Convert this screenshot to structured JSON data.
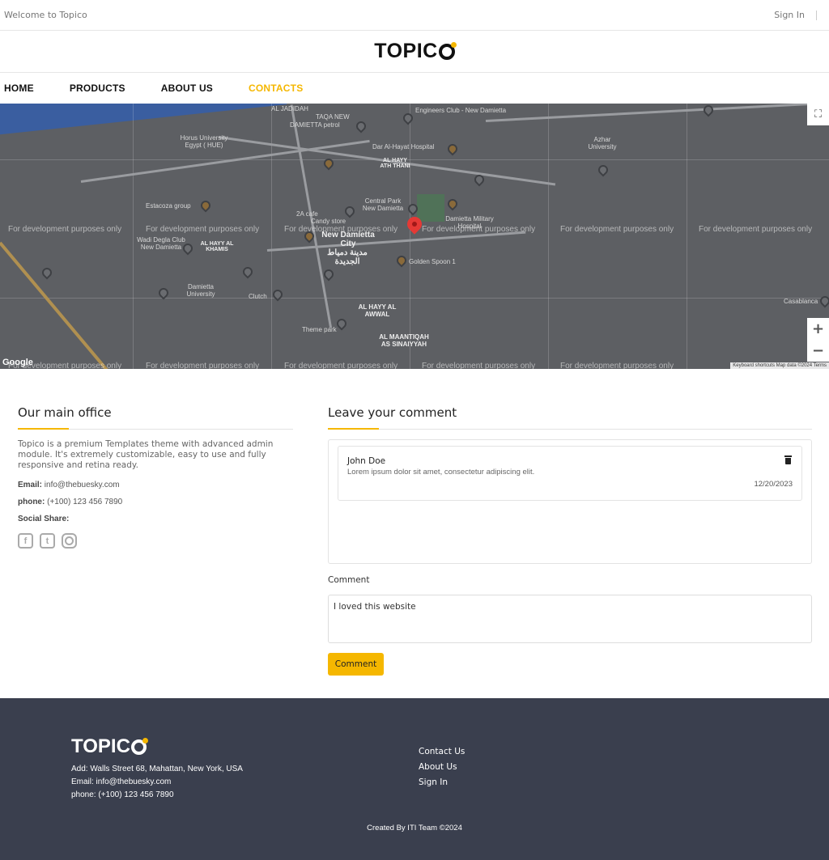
{
  "topbar": {
    "welcome": "Welcome to Topico",
    "signin": "Sign In"
  },
  "brand": {
    "logo_main": "TOPIC",
    "logo_end": "O"
  },
  "nav": {
    "items": [
      {
        "label": "HOME"
      },
      {
        "label": "PRODUCTS"
      },
      {
        "label": "ABOUT US"
      },
      {
        "label": "CONTACTS"
      }
    ],
    "active": "CONTACTS"
  },
  "map": {
    "dev_watermark": "For development purposes only",
    "city_label_en": "New Damietta City",
    "city_label_ar": "مدينة دمياط الجديدة",
    "places": [
      "AL JADIDAH",
      "TAQA NEW",
      "DAMIETTA petrol",
      "Engineers Club - New Damietta",
      "Horus University Egypt ( HUE)",
      "Dar Al-Hayat Hospital",
      "AL HAYY ATH THANI",
      "Azhar University",
      "Estacoza group",
      "Central Park New Damietta",
      "2A cafe",
      "Candy store",
      "Damietta Military Hospital",
      "Wadi Degla Club New Damietta",
      "AL HAYY AL KHAMIS",
      "Golden Spoon 1",
      "Damietta University",
      "Clutch",
      "AL HAYY AL AWWAL",
      "Theme park",
      "AL MAANTIQAH AS SINAIYYAH",
      "Casablanca"
    ],
    "attribution": "Keyboard shortcuts   Map data ©2024   Terms",
    "google": "Google"
  },
  "office": {
    "title": "Our main office",
    "description": "Topico is a premium Templates theme with advanced admin module. It's extremely customizable, easy to use and fully responsive and retina ready.",
    "email_label": "Email:",
    "email": "info@thebuesky.com",
    "phone_label": "phone:",
    "phone": "(+100) 123 456 7890",
    "social_label": "Social Share:"
  },
  "comments": {
    "title": "Leave your comment",
    "items": [
      {
        "author": "John Doe",
        "text": "Lorem ipsum dolor sit amet, consectetur adipiscing elit.",
        "date": "12/20/2023"
      }
    ],
    "field_label": "Comment",
    "field_value": "I loved this website",
    "button": "Comment"
  },
  "footer": {
    "address": "Add: Walls Street 68, Mahattan, New York, USA",
    "email": "Email: info@thebuesky.com",
    "phone": "phone: (+100) 123 456 7890",
    "links": [
      "Contact Us",
      "About Us",
      "Sign In"
    ],
    "copyright": "Created By ITI Team ©2024"
  },
  "colors": {
    "accent": "#f5b700",
    "footer_bg": "#3a3f4e",
    "map_bg": "#5d5f63"
  }
}
